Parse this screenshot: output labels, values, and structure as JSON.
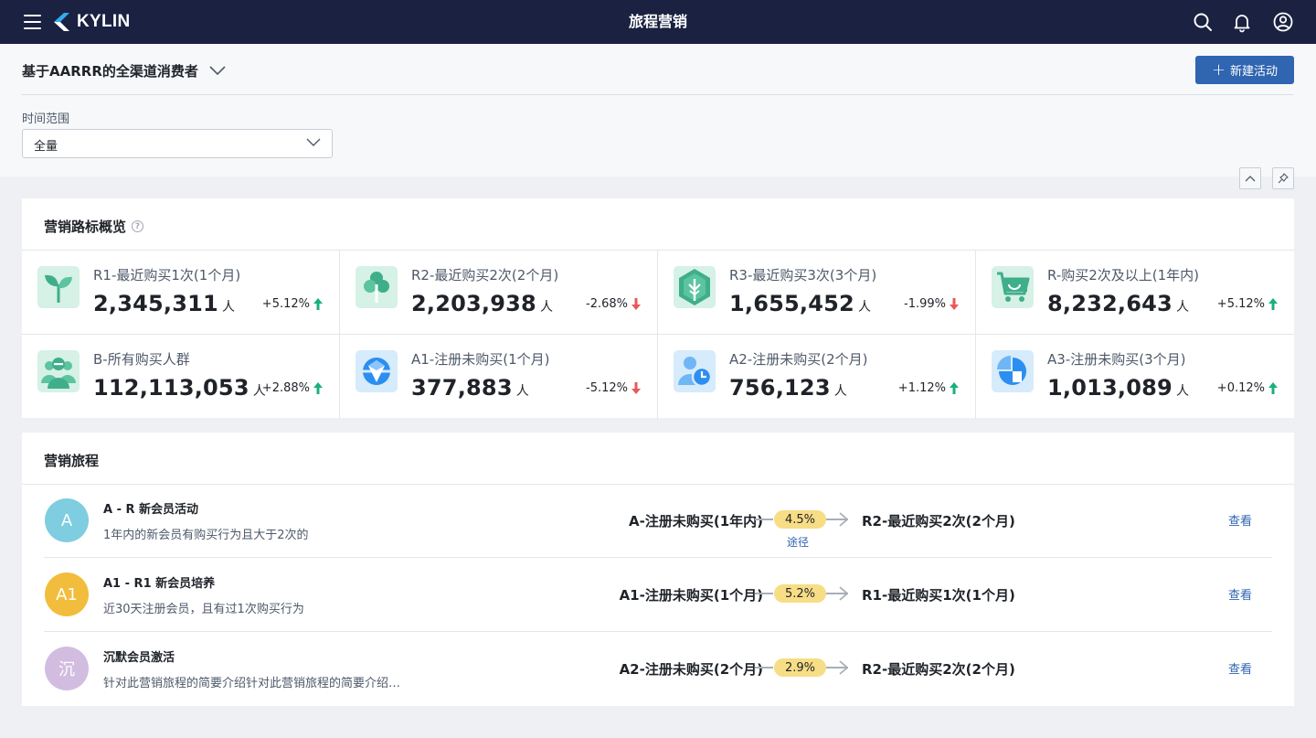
{
  "app": {
    "brand": "KYLIN",
    "title": "旅程营销"
  },
  "page": {
    "breadcrumb": "基于AARRR的全渠道消费者",
    "new_button": "新建活动",
    "filter": {
      "label": "时间范围",
      "value": "全量"
    }
  },
  "overview": {
    "title": "营销路标概览",
    "help_icon": "question-circle-icon",
    "metrics": [
      {
        "label": "R1-最近购买1次(1个月)",
        "value": "2,345,311",
        "unit": "人",
        "change": "+5.12%",
        "trend": "up",
        "icon": "sprout-icon",
        "icon_bg": "#d6f1e6"
      },
      {
        "label": "R2-最近购买2次(2个月)",
        "value": "2,203,938",
        "unit": "人",
        "change": "-2.68%",
        "trend": "down",
        "icon": "tree-icon",
        "icon_bg": "#d6f1e6"
      },
      {
        "label": "R3-最近购买3次(3个月)",
        "value": "1,655,452",
        "unit": "人",
        "change": "-1.99%",
        "trend": "down",
        "icon": "hexagon-tree-icon",
        "icon_bg": "#d6f1e6"
      },
      {
        "label": "R-购买2次及以上(1年内)",
        "value": "8,232,643",
        "unit": "人",
        "change": "+5.12%",
        "trend": "up",
        "icon": "shopping-cart-icon",
        "icon_bg": "#d6f1e6"
      },
      {
        "label": "B-所有购买人群",
        "value": "112,113,053",
        "unit": "人",
        "change": "+2.88%",
        "trend": "up",
        "icon": "user-group-icon",
        "icon_bg": "#d6f1e6"
      },
      {
        "label": "A1-注册未购买(1个月)",
        "value": "377,883",
        "unit": "人",
        "change": "-5.12%",
        "trend": "down",
        "icon": "shield-circle-icon",
        "icon_bg": "#d6ebfb"
      },
      {
        "label": "A2-注册未购买(2个月)",
        "value": "756,123",
        "unit": "人",
        "change": "+1.12%",
        "trend": "up",
        "icon": "user-clock-icon",
        "icon_bg": "#d6ebfb"
      },
      {
        "label": "A3-注册未购买(3个月)",
        "value": "1,013,089",
        "unit": "人",
        "change": "+0.12%",
        "trend": "up",
        "icon": "pie-chart-icon",
        "icon_bg": "#d6ebfb"
      }
    ]
  },
  "journeys": {
    "title": "营销旅程",
    "items": [
      {
        "avatar": "A",
        "avatar_color": "#7ecde0",
        "name": "A - R 新会员活动",
        "desc": "1年内的新会员有购买行为且大于2次的",
        "from": "A-注册未购买(1年内)",
        "rate": "4.5%",
        "path_link": "途径",
        "to": "R2-最近购买2次(2个月)",
        "action": "查看"
      },
      {
        "avatar": "A1",
        "avatar_color": "#f2bd3c",
        "name": "A1 - R1 新会员培养",
        "desc": "近30天注册会员，且有过1次购买行为",
        "from": "A1-注册未购买(1个月)",
        "rate": "5.2%",
        "path_link": "",
        "to": "R1-最近购买1次(1个月)",
        "action": "查看"
      },
      {
        "avatar": "沉",
        "avatar_color": "#d2bde0",
        "name": "沉默会员激活",
        "desc": "针对此营销旅程的简要介绍针对此营销旅程的简要介绍…",
        "from": "A2-注册未购买(2个月)",
        "rate": "2.9%",
        "path_link": "",
        "to": "R2-最近购买2次(2个月)",
        "action": "查看"
      }
    ]
  },
  "colors": {
    "nav_bg": "#1a2141",
    "primary": "#2f65b1",
    "up": "#18b07e",
    "down": "#e8585a",
    "badge": "#f7dd85"
  }
}
